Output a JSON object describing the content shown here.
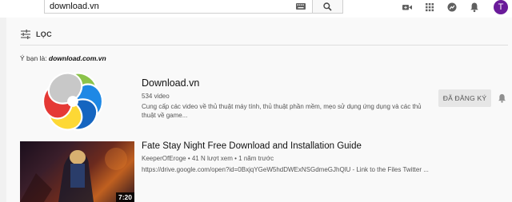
{
  "header": {
    "search_value": "download.vn",
    "avatar_letter": "T"
  },
  "filter": {
    "label": "LỌC"
  },
  "suggestion": {
    "prefix": "Ý bạn là: ",
    "query": "download.com.vn"
  },
  "channel": {
    "title": "Download.vn",
    "video_count": "534 video",
    "description": "Cung cấp các video về thủ thuật máy tính, thủ thuật phần mềm, mẹo sử dụng ứng dụng và các thủ thuật về game...",
    "subscribe_label": "ĐÃ ĐĂNG KÝ",
    "logo_colors": [
      "#8bc34a",
      "#1e88e5",
      "#1565c0",
      "#fdd835",
      "#e53935",
      "#c8c8c8"
    ]
  },
  "video": {
    "title": "Fate Stay Night Free Download and Installation Guide",
    "meta": "KeeperOfEroge • 41 N lượt xem • 1 năm trước",
    "description": "https://drive.google.com/open?id=0BxjqYGeW5hdDWExNSGdmeGJhQlU - Link to the Files Twitter ...",
    "duration": "7:20"
  }
}
